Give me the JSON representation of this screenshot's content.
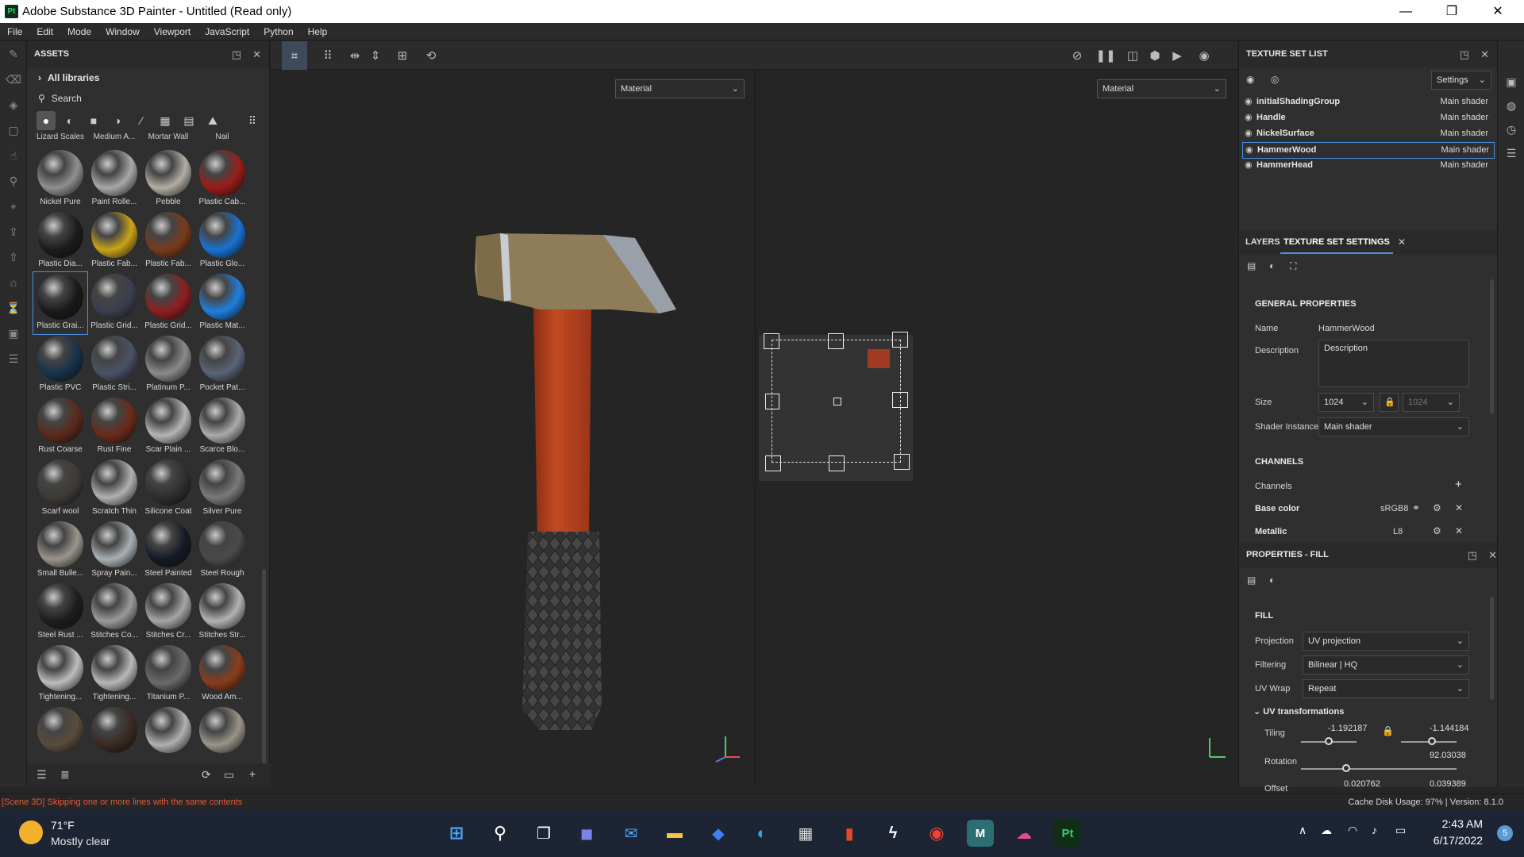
{
  "window": {
    "title": "Adobe Substance 3D Painter - Untitled (Read only)",
    "logo": "Pt",
    "minimize": "—",
    "restore": "❐",
    "close": "✕"
  },
  "menu": [
    "File",
    "Edit",
    "Mode",
    "Window",
    "Viewport",
    "JavaScript",
    "Python",
    "Help"
  ],
  "assets": {
    "title": "ASSETS",
    "libraries": "All libraries",
    "search_placeholder": "Search",
    "header_row": [
      "Lizard Scales",
      "Medium A...",
      "Mortar Wall",
      "Nail"
    ],
    "materials": [
      {
        "label": "Nickel Pure",
        "color": "#8f8f8f"
      },
      {
        "label": "Paint Rolle...",
        "color": "#a8a8a8"
      },
      {
        "label": "Pebble",
        "color": "#b3ada3"
      },
      {
        "label": "Plastic Cab...",
        "color": "#9a1c18"
      },
      {
        "label": "Plastic Dia...",
        "color": "#1c1c1c"
      },
      {
        "label": "Plastic Fab...",
        "color": "#c9a418"
      },
      {
        "label": "Plastic Fab...",
        "color": "#7a3a1c"
      },
      {
        "label": "Plastic Glo...",
        "color": "#1873d4"
      },
      {
        "label": "Plastic Grai...",
        "color": "#1a1a1a"
      },
      {
        "label": "Plastic Grid...",
        "color": "#3a3f4e"
      },
      {
        "label": "Plastic Grid...",
        "color": "#8e1e22"
      },
      {
        "label": "Plastic Mat...",
        "color": "#1f7fe0"
      },
      {
        "label": "Plastic PVC",
        "color": "#16324a"
      },
      {
        "label": "Plastic Stri...",
        "color": "#4a5266"
      },
      {
        "label": "Platinum P...",
        "color": "#8a8a8a"
      },
      {
        "label": "Pocket Pat...",
        "color": "#5a6478"
      },
      {
        "label": "Rust Coarse",
        "color": "#5a2a1c"
      },
      {
        "label": "Rust Fine",
        "color": "#6a2a1a"
      },
      {
        "label": "Scar Plain ...",
        "color": "#b5b5b5"
      },
      {
        "label": "Scarce Blo...",
        "color": "#aaaaaa"
      },
      {
        "label": "Scarf wool",
        "color": "#3e3a36"
      },
      {
        "label": "Scratch Thin",
        "color": "#b0b0b0"
      },
      {
        "label": "Silicone Coat",
        "color": "#2e2e2e"
      },
      {
        "label": "Silver Pure",
        "color": "#7a7a7a"
      },
      {
        "label": "Small Bulle...",
        "color": "#9a958c"
      },
      {
        "label": "Spray Pain...",
        "color": "#a9b0b4"
      },
      {
        "label": "Steel Painted",
        "color": "#141a26"
      },
      {
        "label": "Steel Rough",
        "color": "#4a4a4a"
      },
      {
        "label": "Steel Rust ...",
        "color": "#1e1e1e"
      },
      {
        "label": "Stitches Co...",
        "color": "#9a9a9a"
      },
      {
        "label": "Stitches Cr...",
        "color": "#a5a5a5"
      },
      {
        "label": "Stitches Str...",
        "color": "#b2b2b2"
      },
      {
        "label": "Tightening...",
        "color": "#bdbdbd"
      },
      {
        "label": "Tightening...",
        "color": "#b8b8b8"
      },
      {
        "label": "Titanium P...",
        "color": "#6a6a6a"
      },
      {
        "label": "Wood Am...",
        "color": "#8a3c1c"
      },
      {
        "label": "",
        "color": "#5a4c3c"
      },
      {
        "label": "",
        "color": "#3a2a22"
      },
      {
        "label": "",
        "color": "#b0b0b0"
      },
      {
        "label": "",
        "color": "#9a9488"
      }
    ]
  },
  "viewport": {
    "left_dropdown": "Material",
    "right_dropdown": "Material"
  },
  "texture_set_list": {
    "title": "TEXTURE SET LIST",
    "settings": "Settings",
    "rows": [
      {
        "name": "initialShadingGroup",
        "shader": "Main shader"
      },
      {
        "name": "Handle",
        "shader": "Main shader"
      },
      {
        "name": "NickelSurface",
        "shader": "Main shader"
      },
      {
        "name": "HammerWood",
        "shader": "Main shader"
      },
      {
        "name": "HammerHead",
        "shader": "Main shader"
      }
    ]
  },
  "tss": {
    "tab_layers": "LAYERS",
    "tab_settings": "TEXTURE SET SETTINGS",
    "general_title": "GENERAL PROPERTIES",
    "name_label": "Name",
    "name_value": "HammerWood",
    "description_label": "Description",
    "description_value": "Description",
    "size_label": "Size",
    "size_value": "1024",
    "size_value2": "1024",
    "shader_label": "Shader Instance",
    "shader_value": "Main shader",
    "channels_title": "CHANNELS",
    "channels_label": "Channels",
    "base_color_label": "Base color",
    "base_color_fmt": "sRGB8",
    "metallic_label": "Metallic",
    "metallic_fmt": "L8"
  },
  "fill": {
    "title": "PROPERTIES - FILL",
    "section": "FILL",
    "projection_label": "Projection",
    "projection_value": "UV projection",
    "filtering_label": "Filtering",
    "filtering_value": "Bilinear | HQ",
    "uvwrap_label": "UV Wrap",
    "uvwrap_value": "Repeat",
    "uvtrans_label": "UV transformations",
    "tiling_label": "Tiling",
    "tiling_x": "-1.192187",
    "tiling_y": "-1.144184",
    "rotation_value": "92.03038",
    "rotation_label": "Rotation",
    "offset_label": "Offset",
    "offset_x": "0.020762",
    "offset_y": "0.039389"
  },
  "status": {
    "message": "[Scene 3D] Skipping one or more lines with the same contents",
    "cache": "Cache Disk Usage:    97% | Version: 8.1.0"
  },
  "taskbar": {
    "temp": "71°F",
    "condition": "Mostly clear",
    "time": "2:43 AM",
    "date": "6/17/2022",
    "notifications": "5",
    "app_m": "M",
    "app_pt": "Pt"
  }
}
